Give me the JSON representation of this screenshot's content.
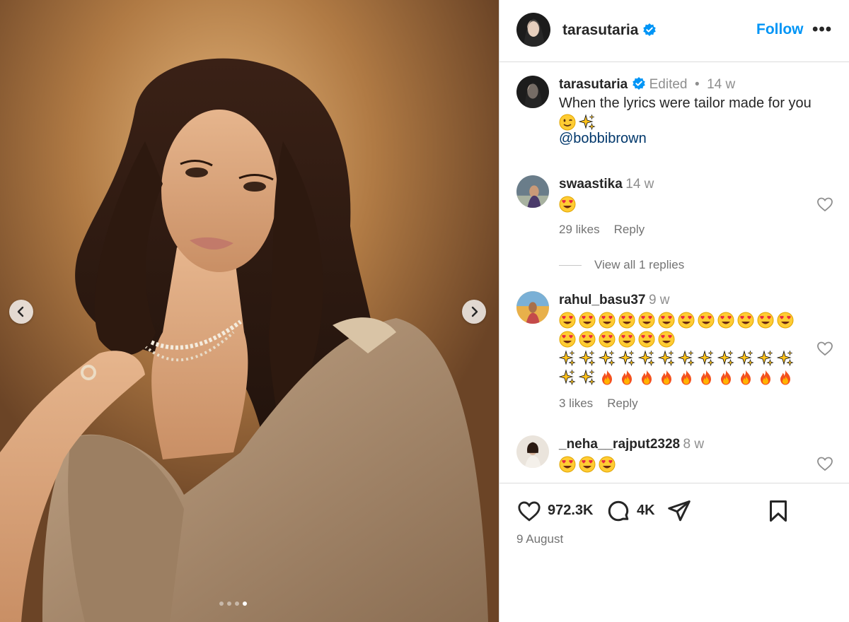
{
  "post": {
    "author": "tarasutaria",
    "follow_label": "Follow",
    "more_label": "•••",
    "media": {
      "current_slide": 4,
      "total_slides": 4
    }
  },
  "caption": {
    "username": "tarasutaria",
    "edited": "Edited",
    "separator": "•",
    "time": "14 w",
    "text": "When the lyrics were tailor made for you",
    "emojis": "😉✨",
    "mention": "@bobbibrown"
  },
  "comments": [
    {
      "username": "swaastika",
      "time": "14 w",
      "text": "😍",
      "likes": "29 likes",
      "reply": "Reply",
      "view_replies": "View all 1 replies"
    },
    {
      "username": "rahul_basu37",
      "time": "9 w",
      "line1": "😍😍😍😍😍😍😍😍😍😍😍😍",
      "line2": "😍😍😍😍😍😍",
      "line3": "✨✨✨✨✨✨✨✨✨✨✨✨",
      "line4": "✨✨🔥🔥🔥🔥🔥🔥🔥🔥🔥🔥",
      "likes": "3 likes",
      "reply": "Reply"
    },
    {
      "username": "_neha__rajput2328",
      "time": "8 w",
      "text": "😍😍😍"
    }
  ],
  "footer": {
    "likes_count": "972.3K",
    "comments_count": "4K",
    "date": "9 August"
  },
  "colors": {
    "accent": "#0095f6",
    "verified": "#0095f6",
    "mention": "#00376b",
    "muted": "#8e8e8e"
  },
  "icons": [
    "chevron-left-icon",
    "chevron-right-icon",
    "verified-icon",
    "more-icon",
    "heart-icon",
    "comment-icon",
    "share-icon",
    "bookmark-icon"
  ]
}
